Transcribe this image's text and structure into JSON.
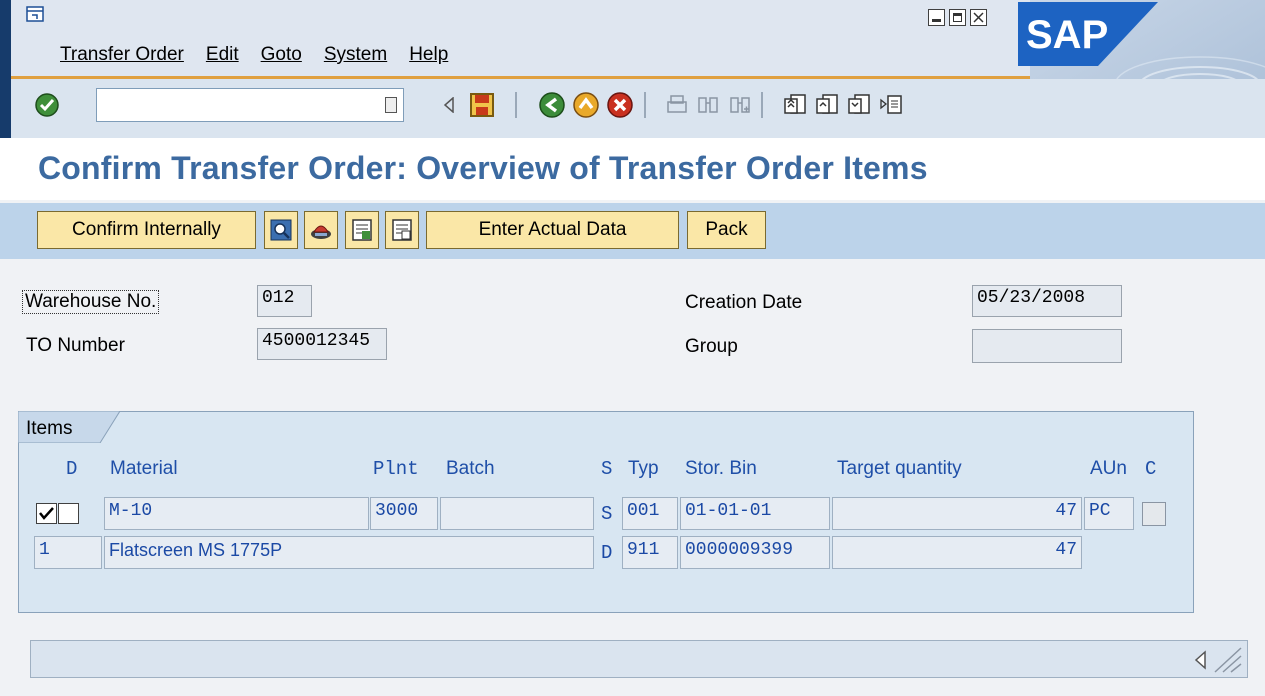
{
  "window": {
    "menu": [
      "Transfer Order",
      "Edit",
      "Goto",
      "System",
      "Help"
    ],
    "brand": "SAP"
  },
  "toolbar": {
    "command_field_value": "",
    "icons": [
      "enter-icon",
      "command-history-icon",
      "back-arrow-icon",
      "save-icon",
      "back-icon",
      "exit-icon",
      "cancel-icon",
      "print-icon",
      "find-icon",
      "find-next-icon",
      "first-page-icon",
      "previous-page-icon",
      "next-page-icon",
      "last-page-icon"
    ]
  },
  "page": {
    "title": "Confirm Transfer Order: Overview of Transfer Order Items"
  },
  "app_toolbar": {
    "confirm_internally": "Confirm Internally",
    "enter_actual_data": "Enter Actual Data",
    "pack": "Pack",
    "icons": [
      "details-icon",
      "putaway-icon",
      "select-all-icon",
      "deselect-all-icon"
    ]
  },
  "header": {
    "warehouse_label": "Warehouse No.",
    "warehouse_value": "012",
    "to_number_label": "TO Number",
    "to_number_value": "4500012345",
    "creation_date_label": "Creation Date",
    "creation_date_value": "05/23/2008",
    "group_label": "Group",
    "group_value": ""
  },
  "items": {
    "tab_label": "Items",
    "columns": {
      "d": "D",
      "material": "Material",
      "plnt": "Plnt",
      "batch": "Batch",
      "s": "S",
      "typ": "Typ",
      "stor_bin": "Stor. Bin",
      "target_quantity": "Target quantity",
      "aun": "AUn",
      "c": "C"
    },
    "rows": [
      {
        "material": "M-10",
        "plnt": "3000",
        "batch": "",
        "s": "S",
        "typ": "001",
        "stor_bin": "01-01-01",
        "target_quantity": "47",
        "aun": "PC",
        "d_checked": true,
        "c_checked": false
      },
      {
        "item": "1",
        "material": "Flatscreen MS 1775P",
        "s": "D",
        "typ": "911",
        "stor_bin": "0000009399",
        "target_quantity": "47"
      }
    ]
  },
  "colors": {
    "title_blue": "#3c6aa0",
    "button_yellow": "#fae7a7",
    "app_toolbar_blue": "#bcd3ea",
    "sap_blue": "#1d63c2"
  }
}
